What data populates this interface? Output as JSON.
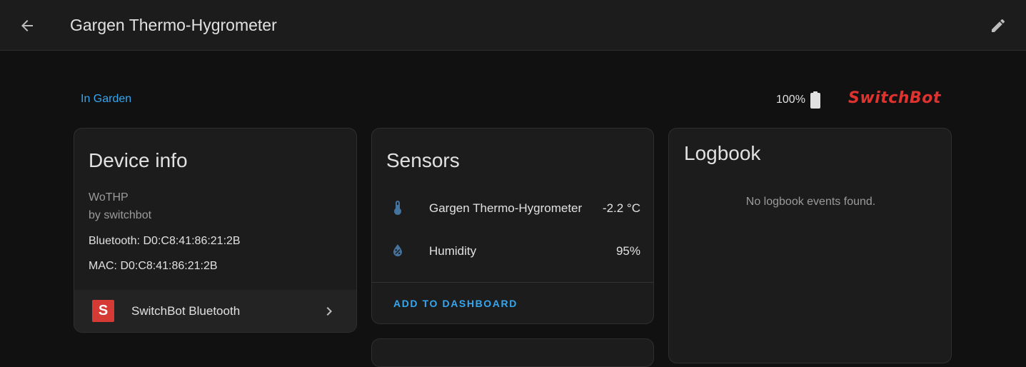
{
  "header": {
    "title": "Gargen Thermo-Hygrometer",
    "back_icon": "arrow-left-icon",
    "edit_icon": "pencil-icon"
  },
  "area": {
    "label": "In Garden"
  },
  "battery": {
    "level_text": "100%",
    "level": 100,
    "icon": "battery-icon"
  },
  "brand": {
    "logo_text": "SwitchBot",
    "color": "#e0322e"
  },
  "device_info": {
    "title": "Device info",
    "model": "WoTHP",
    "manufacturer": "by switchbot",
    "connections": [
      "Bluetooth: D0:C8:41:86:21:2B",
      "MAC: D0:C8:41:86:21:2B"
    ],
    "integration": {
      "logo_letter": "S",
      "name": "SwitchBot Bluetooth"
    }
  },
  "sensors": {
    "title": "Sensors",
    "items": [
      {
        "icon": "thermometer-icon",
        "name": "Gargen Thermo-Hygrometer",
        "value": "-2.2 °C"
      },
      {
        "icon": "water-percent-icon",
        "name": "Humidity",
        "value": "95%"
      }
    ],
    "action": "ADD TO DASHBOARD"
  },
  "logbook": {
    "title": "Logbook",
    "empty_text": "No logbook events found."
  },
  "colors": {
    "accent": "#34a7f0",
    "icon_blue": "#44739e",
    "background": "#111111",
    "card": "#1c1c1c"
  }
}
